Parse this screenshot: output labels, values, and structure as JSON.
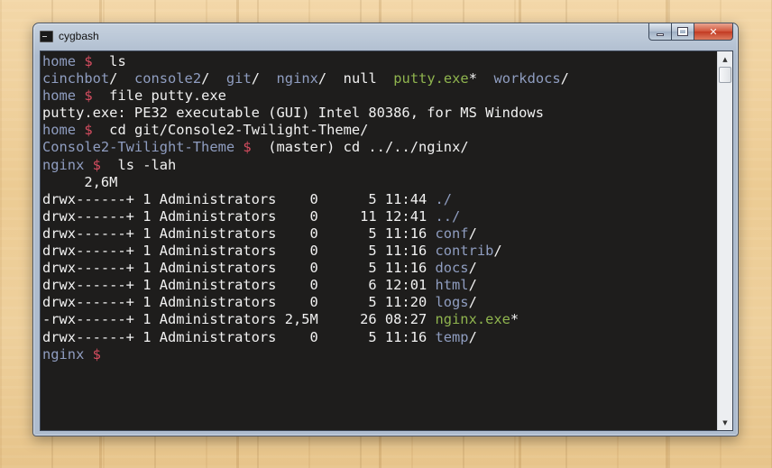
{
  "window": {
    "title": "cygbash",
    "icon": "terminal-icon",
    "controls": [
      "minimize-icon",
      "maximize-icon",
      "close-icon"
    ]
  },
  "colors": {
    "prompt": "#8f9dc0",
    "dollar": "#d64d60",
    "directory": "#8f9dc0",
    "executable": "#8fb44e",
    "text": "#f1f1f1",
    "background": "#1e1d1c"
  },
  "terminal": {
    "lines": [
      [
        {
          "t": "home",
          "c": "prompt"
        },
        {
          "t": " "
        },
        {
          "t": "$",
          "c": "dollar"
        },
        {
          "t": "  ls"
        }
      ],
      [
        {
          "t": "cinchbot",
          "c": "dir"
        },
        {
          "t": "/  "
        },
        {
          "t": "console2",
          "c": "dir"
        },
        {
          "t": "/  "
        },
        {
          "t": "git",
          "c": "dir"
        },
        {
          "t": "/  "
        },
        {
          "t": "nginx",
          "c": "dir"
        },
        {
          "t": "/  null  "
        },
        {
          "t": "putty.exe",
          "c": "exe"
        },
        {
          "t": "*  "
        },
        {
          "t": "workdocs",
          "c": "dir"
        },
        {
          "t": "/"
        }
      ],
      [
        {
          "t": "home",
          "c": "prompt"
        },
        {
          "t": " "
        },
        {
          "t": "$",
          "c": "dollar"
        },
        {
          "t": "  file putty.exe"
        }
      ],
      [
        {
          "t": "putty.exe: PE32 executable (GUI) Intel 80386, for MS Windows"
        }
      ],
      [
        {
          "t": "home",
          "c": "prompt"
        },
        {
          "t": " "
        },
        {
          "t": "$",
          "c": "dollar"
        },
        {
          "t": "  cd git/Console2-Twilight-Theme/"
        }
      ],
      [
        {
          "t": "Console2-Twilight-Theme",
          "c": "prompt"
        },
        {
          "t": " "
        },
        {
          "t": "$",
          "c": "dollar"
        },
        {
          "t": "  (master) cd ../../nginx/"
        }
      ],
      [
        {
          "t": "nginx",
          "c": "prompt"
        },
        {
          "t": " "
        },
        {
          "t": "$",
          "c": "dollar"
        },
        {
          "t": "  ls -lah"
        }
      ],
      [
        {
          "t": "     2,6M"
        }
      ],
      [
        {
          "t": "drwx------+ 1 Administrators    0      5 11:44 "
        },
        {
          "t": "./",
          "c": "dir"
        }
      ],
      [
        {
          "t": "drwx------+ 1 Administrators    0     11 12:41 "
        },
        {
          "t": "../",
          "c": "dir"
        }
      ],
      [
        {
          "t": "drwx------+ 1 Administrators    0      5 11:16 "
        },
        {
          "t": "conf",
          "c": "dir"
        },
        {
          "t": "/"
        }
      ],
      [
        {
          "t": "drwx------+ 1 Administrators    0      5 11:16 "
        },
        {
          "t": "contrib",
          "c": "dir"
        },
        {
          "t": "/"
        }
      ],
      [
        {
          "t": "drwx------+ 1 Administrators    0      5 11:16 "
        },
        {
          "t": "docs",
          "c": "dir"
        },
        {
          "t": "/"
        }
      ],
      [
        {
          "t": "drwx------+ 1 Administrators    0      6 12:01 "
        },
        {
          "t": "html",
          "c": "dir"
        },
        {
          "t": "/"
        }
      ],
      [
        {
          "t": "drwx------+ 1 Administrators    0      5 11:20 "
        },
        {
          "t": "logs",
          "c": "dir"
        },
        {
          "t": "/"
        }
      ],
      [
        {
          "t": "-rwx------+ 1 Administrators 2,5M     26 08:27 "
        },
        {
          "t": "nginx.exe",
          "c": "exe"
        },
        {
          "t": "*"
        }
      ],
      [
        {
          "t": "drwx------+ 1 Administrators    0      5 11:16 "
        },
        {
          "t": "temp",
          "c": "dir"
        },
        {
          "t": "/"
        }
      ],
      [
        {
          "t": "nginx",
          "c": "prompt"
        },
        {
          "t": " "
        },
        {
          "t": "$",
          "c": "dollar"
        }
      ]
    ]
  },
  "scrollbar": {
    "up_icon": "arrow-up-icon",
    "down_icon": "arrow-down-icon",
    "position": 0
  }
}
